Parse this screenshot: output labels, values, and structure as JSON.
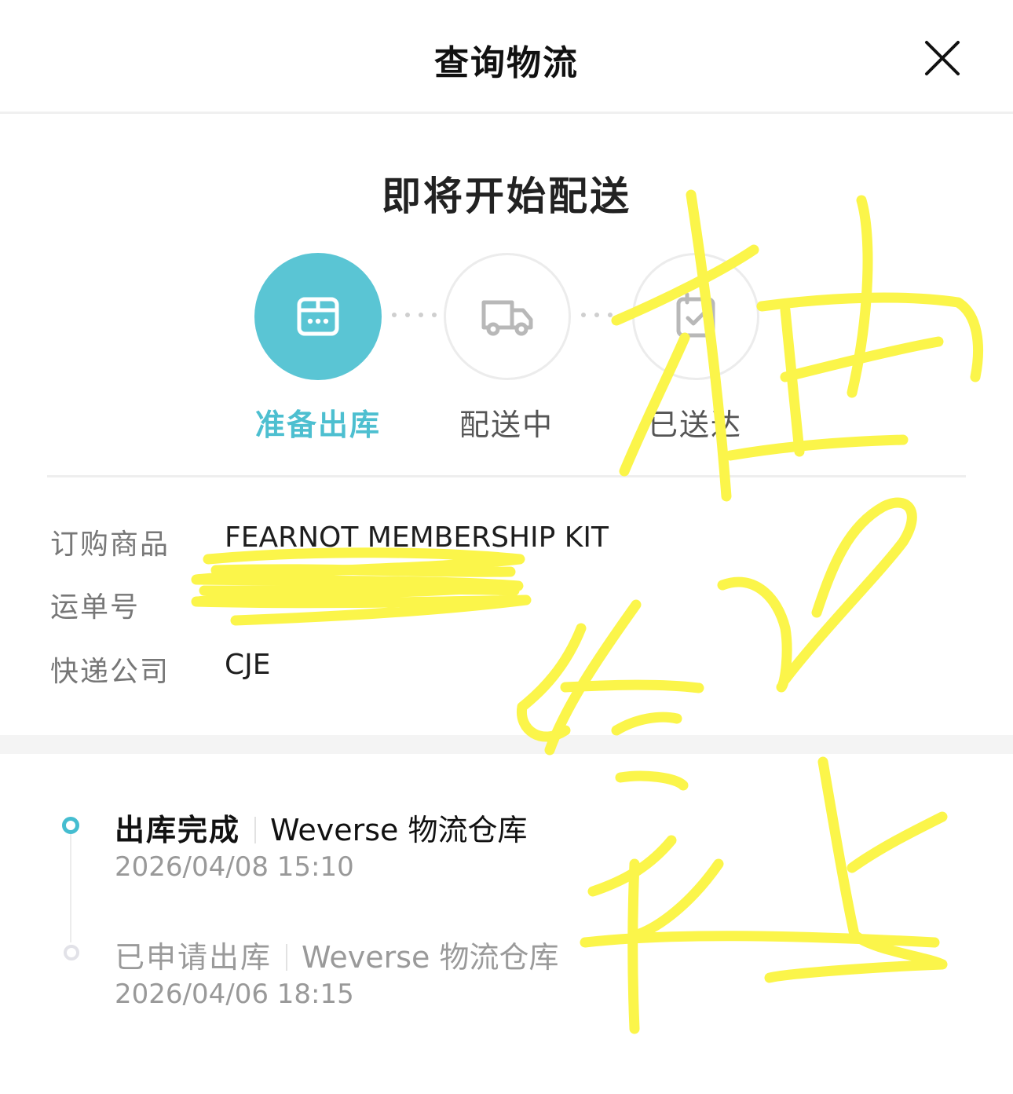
{
  "header": {
    "title": "查询物流",
    "close_icon": "close-icon"
  },
  "status": {
    "title": "即将开始配送",
    "steps": [
      {
        "label": "准备出库",
        "icon": "box-icon",
        "active": true
      },
      {
        "label": "配送中",
        "icon": "truck-icon",
        "active": false
      },
      {
        "label": "已送达",
        "icon": "calendar-check-icon",
        "active": false
      }
    ]
  },
  "info": {
    "rows": [
      {
        "key": "订购商品",
        "value": "FEARNOT MEMBERSHIP KIT"
      },
      {
        "key": "运单号",
        "value": ""
      },
      {
        "key": "快递公司",
        "value": "CJE"
      }
    ]
  },
  "timeline": [
    {
      "status": "出库完成",
      "location": "Weverse 物流仓库",
      "time": "2026/04/08 15:10",
      "current": true
    },
    {
      "status": "已申请出库",
      "location": "Weverse 物流仓库",
      "time": "2026/04/06 18:15",
      "current": false
    }
  ],
  "colors": {
    "accent": "#5ac5d4",
    "scribble": "#fbf54a"
  }
}
